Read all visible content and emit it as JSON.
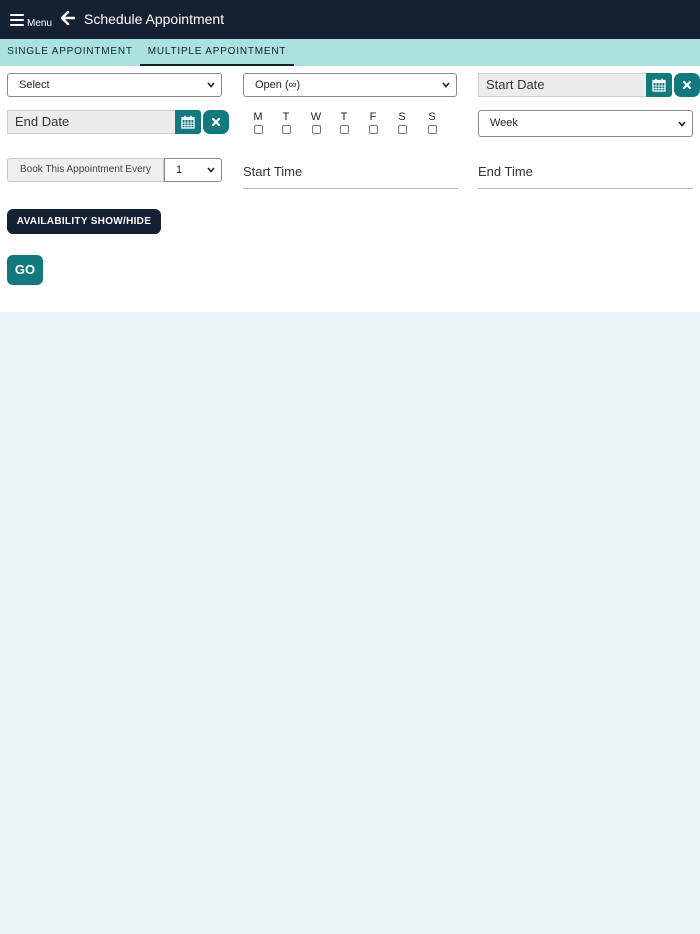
{
  "header": {
    "menu_label": "Menu",
    "title": "Schedule Appointment",
    "back_icon": "arrow-left-icon",
    "menu_icon": "hamburger-icon"
  },
  "tabs": [
    {
      "label": "SINGLE APPOINTMENT",
      "active": false
    },
    {
      "label": "MULTIPLE APPOINTMENT",
      "active": true
    }
  ],
  "form": {
    "type_select": "Select",
    "status_select": "Open (∞)",
    "start_date_placeholder": "Start Date",
    "end_date_placeholder": "End Date",
    "days": [
      "M",
      "T",
      "W",
      "T",
      "F",
      "S",
      "S"
    ],
    "repeat_select": "Week",
    "book_every_label": "Book This Appointment Every",
    "book_every_value": "1",
    "start_time_placeholder": "Start Time",
    "end_time_placeholder": "End Time"
  },
  "buttons": {
    "availability": "AVAILABILITY SHOW/HIDE",
    "go": "GO"
  },
  "colors": {
    "header_bg": "#142133",
    "tab_bar_bg": "#a9e2df",
    "accent_teal": "#127a7e",
    "page_bg": "#eaf6f5"
  }
}
